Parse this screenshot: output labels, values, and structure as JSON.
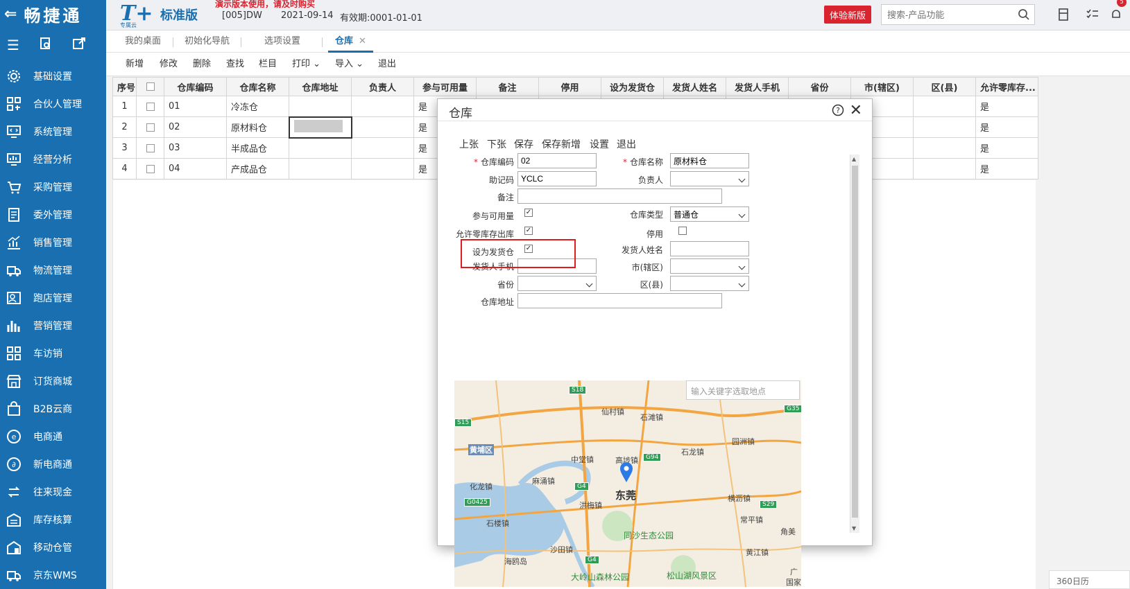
{
  "sidebar": {
    "brand": "畅捷通",
    "items": [
      {
        "label": "基础设置",
        "icon": "settings-gear-icon"
      },
      {
        "label": "合伙人管理",
        "icon": "partner-grid-icon"
      },
      {
        "label": "系统管理",
        "icon": "monitor-code-icon"
      },
      {
        "label": "经营分析",
        "icon": "monitor-chart-icon"
      },
      {
        "label": "采购管理",
        "icon": "cart-icon"
      },
      {
        "label": "委外管理",
        "icon": "outsource-doc-icon"
      },
      {
        "label": "销售管理",
        "icon": "sales-chart-icon"
      },
      {
        "label": "物流管理",
        "icon": "truck-icon"
      },
      {
        "label": "跑店管理",
        "icon": "store-visit-icon"
      },
      {
        "label": "营销管理",
        "icon": "marketing-bars-icon"
      },
      {
        "label": "车访销",
        "icon": "car-sales-icon"
      },
      {
        "label": "订货商城",
        "icon": "shop-icon"
      },
      {
        "label": "B2B云商",
        "icon": "bag-icon"
      },
      {
        "label": "电商通",
        "icon": "ecommerce-e-icon"
      },
      {
        "label": "新电商通",
        "icon": "new-ecommerce-icon"
      },
      {
        "label": "往来现金",
        "icon": "cash-flow-icon"
      },
      {
        "label": "库存核算",
        "icon": "inventory-icon"
      },
      {
        "label": "移动仓管",
        "icon": "mobile-warehouse-icon"
      },
      {
        "label": "京东WMS",
        "icon": "wms-truck-icon"
      }
    ]
  },
  "header": {
    "logo": "T+",
    "logo_sub": "专属云",
    "edition": "标准版",
    "demo_note": "演示版本使用，请及时购买",
    "account": "[005]DW",
    "date": "2021-09-14",
    "validity": "有效期:0001-01-01",
    "try_button": "体验新版",
    "search_placeholder": "搜索-产品功能",
    "badge": "5"
  },
  "tabs": [
    {
      "label": "我的桌面"
    },
    {
      "label": "初始化导航"
    },
    {
      "label": "选项设置"
    },
    {
      "label": "仓库",
      "active": true
    }
  ],
  "toolbar": [
    "新增",
    "修改",
    "删除",
    "查找",
    "栏目",
    "打印",
    "导入",
    "退出"
  ],
  "grid": {
    "columns": [
      "序号",
      "",
      "仓库编码",
      "仓库名称",
      "仓库地址",
      "负责人",
      "参与可用量",
      "备注",
      "停用",
      "设为发货仓",
      "发货人姓名",
      "发货人手机",
      "省份",
      "市(辖区)",
      "区(县)",
      "允许零库存..."
    ],
    "rows": [
      {
        "no": "1",
        "code": "01",
        "name": "冷冻仓",
        "avail": "是",
        "zero": "是"
      },
      {
        "no": "2",
        "code": "02",
        "name": "原材料仓",
        "avail": "是",
        "zero": "是"
      },
      {
        "no": "3",
        "code": "03",
        "name": "半成品仓",
        "avail": "是",
        "zero": "是"
      },
      {
        "no": "4",
        "code": "04",
        "name": "产成品仓",
        "avail": "是",
        "zero": "是"
      }
    ]
  },
  "modal": {
    "title": "仓库",
    "toolbar": [
      "上张",
      "下张",
      "保存",
      "保存新增",
      "设置",
      "退出"
    ],
    "labels": {
      "code": "仓库编码",
      "name": "仓库名称",
      "mnemonic": "助记码",
      "manager": "负责人",
      "remark": "备注",
      "available": "参与可用量",
      "wh_type": "仓库类型",
      "allow_zero": "允许零库存出库",
      "disabled": "停用",
      "ship_wh": "设为发货仓",
      "shipper_name": "发货人姓名",
      "shipper_phone": "发货人手机",
      "city": "市(辖区)",
      "province": "省份",
      "district": "区(县)",
      "address": "仓库地址"
    },
    "values": {
      "code": "02",
      "name": "原材料仓",
      "mnemonic": "YCLC",
      "wh_type": "普通仓"
    },
    "map": {
      "search_placeholder": "输入关键字选取地点",
      "places": [
        "仙村镇",
        "石滩镇",
        "中堂镇",
        "高埗镇",
        "石龙镇",
        "园洲镇",
        "黄埔区",
        "麻涌镇",
        "化龙镇",
        "东莞",
        "横沥镇",
        "洪梅镇",
        "常平镇",
        "石楼镇",
        "沙田镇",
        "同沙生态公园",
        "海鸥岛",
        "大岭山森林公园",
        "松山湖风景区",
        "黄江镇",
        "角美",
        "广",
        "国家"
      ],
      "roads": [
        "S18",
        "G35",
        "S15",
        "G94",
        "G4",
        "G0425",
        "S29",
        "G4"
      ]
    }
  },
  "calendar": "360日历"
}
